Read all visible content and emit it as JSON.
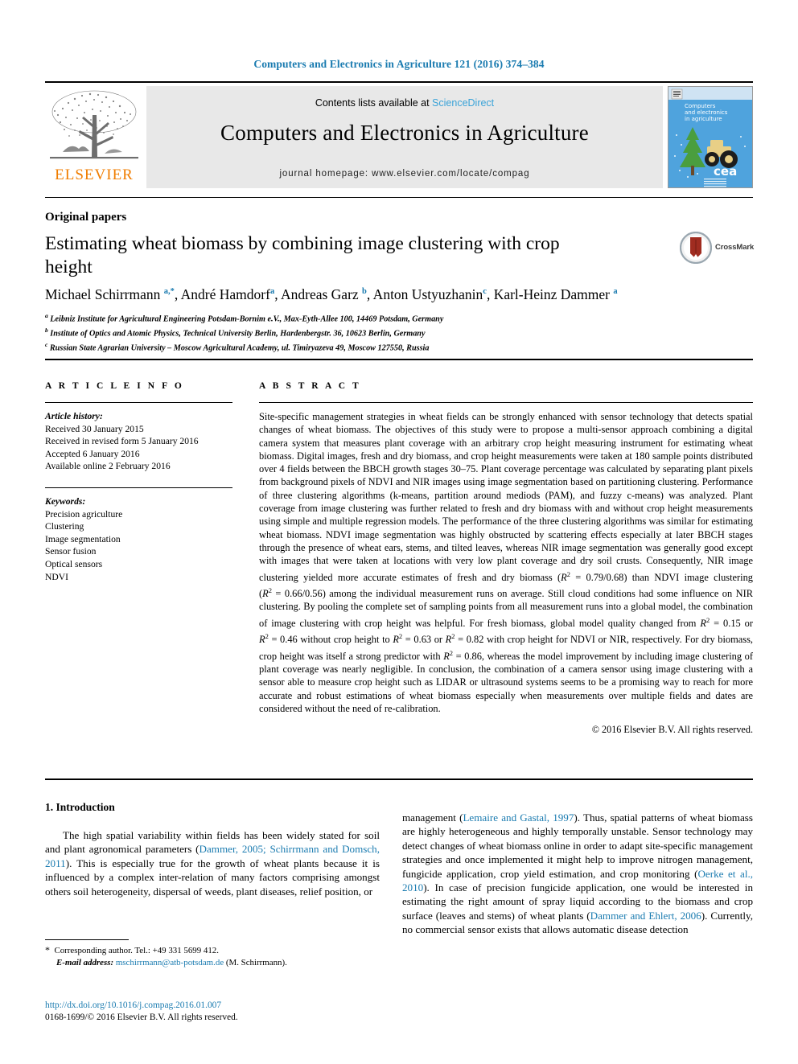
{
  "running_head": "Computers and Electronics in Agriculture 121 (2016) 374–384",
  "masthead": {
    "contents_prefix": "Contents lists available at ",
    "sciencedirect": "ScienceDirect",
    "journal_title": "Computers and Electronics in Agriculture",
    "homepage": "journal homepage: www.elsevier.com/locate/compag",
    "publisher": "ELSEVIER",
    "cover_title_line1": "Computers",
    "cover_title_line2": "and electronics",
    "cover_title_line3": "in agriculture",
    "cover_badge": "cea",
    "accent_orange": "#f07d00",
    "accent_blue": "#3aa3d8",
    "link_blue": "#1a7bb0"
  },
  "article": {
    "kicker": "Original papers",
    "title": "Estimating wheat biomass by combining image clustering with crop height",
    "crossmark_label": "CrossMark",
    "authors_html": "Michael Schirrmann <sup>a,*</sup>, André Hamdorf<sup>a</sup>, Andreas Garz <sup>b</sup>, Anton Ustyuzhanin<sup>c</sup>, Karl-Heinz Dammer <sup>a</sup>",
    "affiliations": [
      "Leibniz Institute for Agricultural Engineering Potsdam-Bornim e.V., Max-Eyth-Allee 100, 14469 Potsdam, Germany",
      "Institute of Optics and Atomic Physics, Technical University Berlin, Hardenbergstr. 36, 10623 Berlin, Germany",
      "Russian State Agrarian University – Moscow Agricultural Academy, ul. Timiryazeva 49, Moscow 127550, Russia"
    ],
    "affiliation_marks": [
      "a",
      "b",
      "c"
    ]
  },
  "article_info": {
    "heading": "A R T I C L E   I N F O",
    "history_label": "Article history:",
    "history": [
      "Received 30 January 2015",
      "Received in revised form 5 January 2016",
      "Accepted 6 January 2016",
      "Available online 2 February 2016"
    ],
    "keywords_label": "Keywords:",
    "keywords": [
      "Precision agriculture",
      "Clustering",
      "Image segmentation",
      "Sensor fusion",
      "Optical sensors",
      "NDVI"
    ]
  },
  "abstract": {
    "heading": "A B S T R A C T",
    "body_html": "Site-specific management strategies in wheat fields can be strongly enhanced with sensor technology that detects spatial changes of wheat biomass. The objectives of this study were to propose a multi-sensor approach combining a digital camera system that measures plant coverage with an arbitrary crop height measuring instrument for estimating wheat biomass. Digital images, fresh and dry biomass, and crop height measurements were taken at 180 sample points distributed over 4 fields between the BBCH growth stages 30&ndash;75. Plant coverage percentage was calculated by separating plant pixels from background pixels of NDVI and NIR images using image segmentation based on partitioning clustering. Performance of three clustering algorithms (k-means, partition around mediods (PAM), and fuzzy c-means) was analyzed. Plant coverage from image clustering was further related to fresh and dry biomass with and without crop height measurements using simple and multiple regression models. The performance of the three clustering algorithms was similar for estimating wheat biomass. NDVI image segmentation was highly obstructed by scattering effects especially at later BBCH stages through the presence of wheat ears, stems, and tilted leaves, whereas NIR image segmentation was generally good except with images that were taken at locations with very low plant coverage and dry soil crusts. Consequently, NIR image clustering yielded more accurate estimates of fresh and dry biomass (<i>R</i><sup>2</sup>&nbsp;=&nbsp;0.79/0.68) than NDVI image clustering (<i>R</i><sup>2</sup>&nbsp;=&nbsp;0.66/0.56) among the individual measurement runs on average. Still cloud conditions had some influence on NIR clustering. By pooling the complete set of sampling points from all measurement runs into a global model, the combination of image clustering with crop height was helpful. For fresh biomass, global model quality changed from <i>R</i><sup>2</sup>&nbsp;=&nbsp;0.15 or <i>R</i><sup>2</sup>&nbsp;=&nbsp;0.46 without crop height to <i>R</i><sup>2</sup>&nbsp;=&nbsp;0.63 or <i>R</i><sup>2</sup>&nbsp;=&nbsp;0.82 with crop height for NDVI or NIR, respectively. For dry biomass, crop height was itself a strong predictor with <i>R</i><sup>2</sup>&nbsp;=&nbsp;0.86, whereas the model improvement by including image clustering of plant coverage was nearly negligible. In conclusion, the combination of a camera sensor using image clustering with a sensor able to measure crop height such as LIDAR or ultrasound systems seems to be a promising way to reach for more accurate and robust estimations of wheat biomass especially when measurements over multiple fields and dates are considered without the need of re-calibration.",
    "copyright": "© 2016 Elsevier B.V. All rights reserved."
  },
  "introduction": {
    "heading": "1. Introduction",
    "left_html": "The high spatial variability within fields has been widely stated for soil and plant agronomical parameters (<span class=\"ref\">Dammer, 2005; Schirrmann and Domsch, 2011</span>). This is especially true for the growth of wheat plants because it is influenced by a complex inter-relation of many factors comprising amongst others soil heterogeneity, dispersal of weeds, plant diseases, relief position, or",
    "right_html": "management (<span class=\"ref\">Lemaire and Gastal, 1997</span>). Thus, spatial patterns of wheat biomass are highly heterogeneous and highly temporally unstable. Sensor technology may detect changes of wheat biomass online in order to adapt site-specific management strategies and once implemented it might help to improve nitrogen management, fungicide application, crop yield estimation, and crop monitoring (<span class=\"ref\">Oerke et al., 2010</span>). In case of precision fungicide application, one would be interested in estimating the right amount of spray liquid according to the biomass and crop surface (leaves and stems) of wheat plants (<span class=\"ref\">Dammer and Ehlert, 2006</span>). Currently, no commercial sensor exists that allows automatic disease detection"
  },
  "footnote": {
    "corresponding_html": "<span class=\"star\">*</span>&nbsp; Corresponding author. Tel.: +49 331 5699 412.",
    "email_html": "<i>E-mail address:</i> <span class=\"ref\">mschirrmann@atb-potsdam.de</span> (M. Schirrmann)."
  },
  "footer": {
    "doi": "http://dx.doi.org/10.1016/j.compag.2016.01.007",
    "issn_line": "0168-1699/© 2016 Elsevier B.V. All rights reserved."
  }
}
